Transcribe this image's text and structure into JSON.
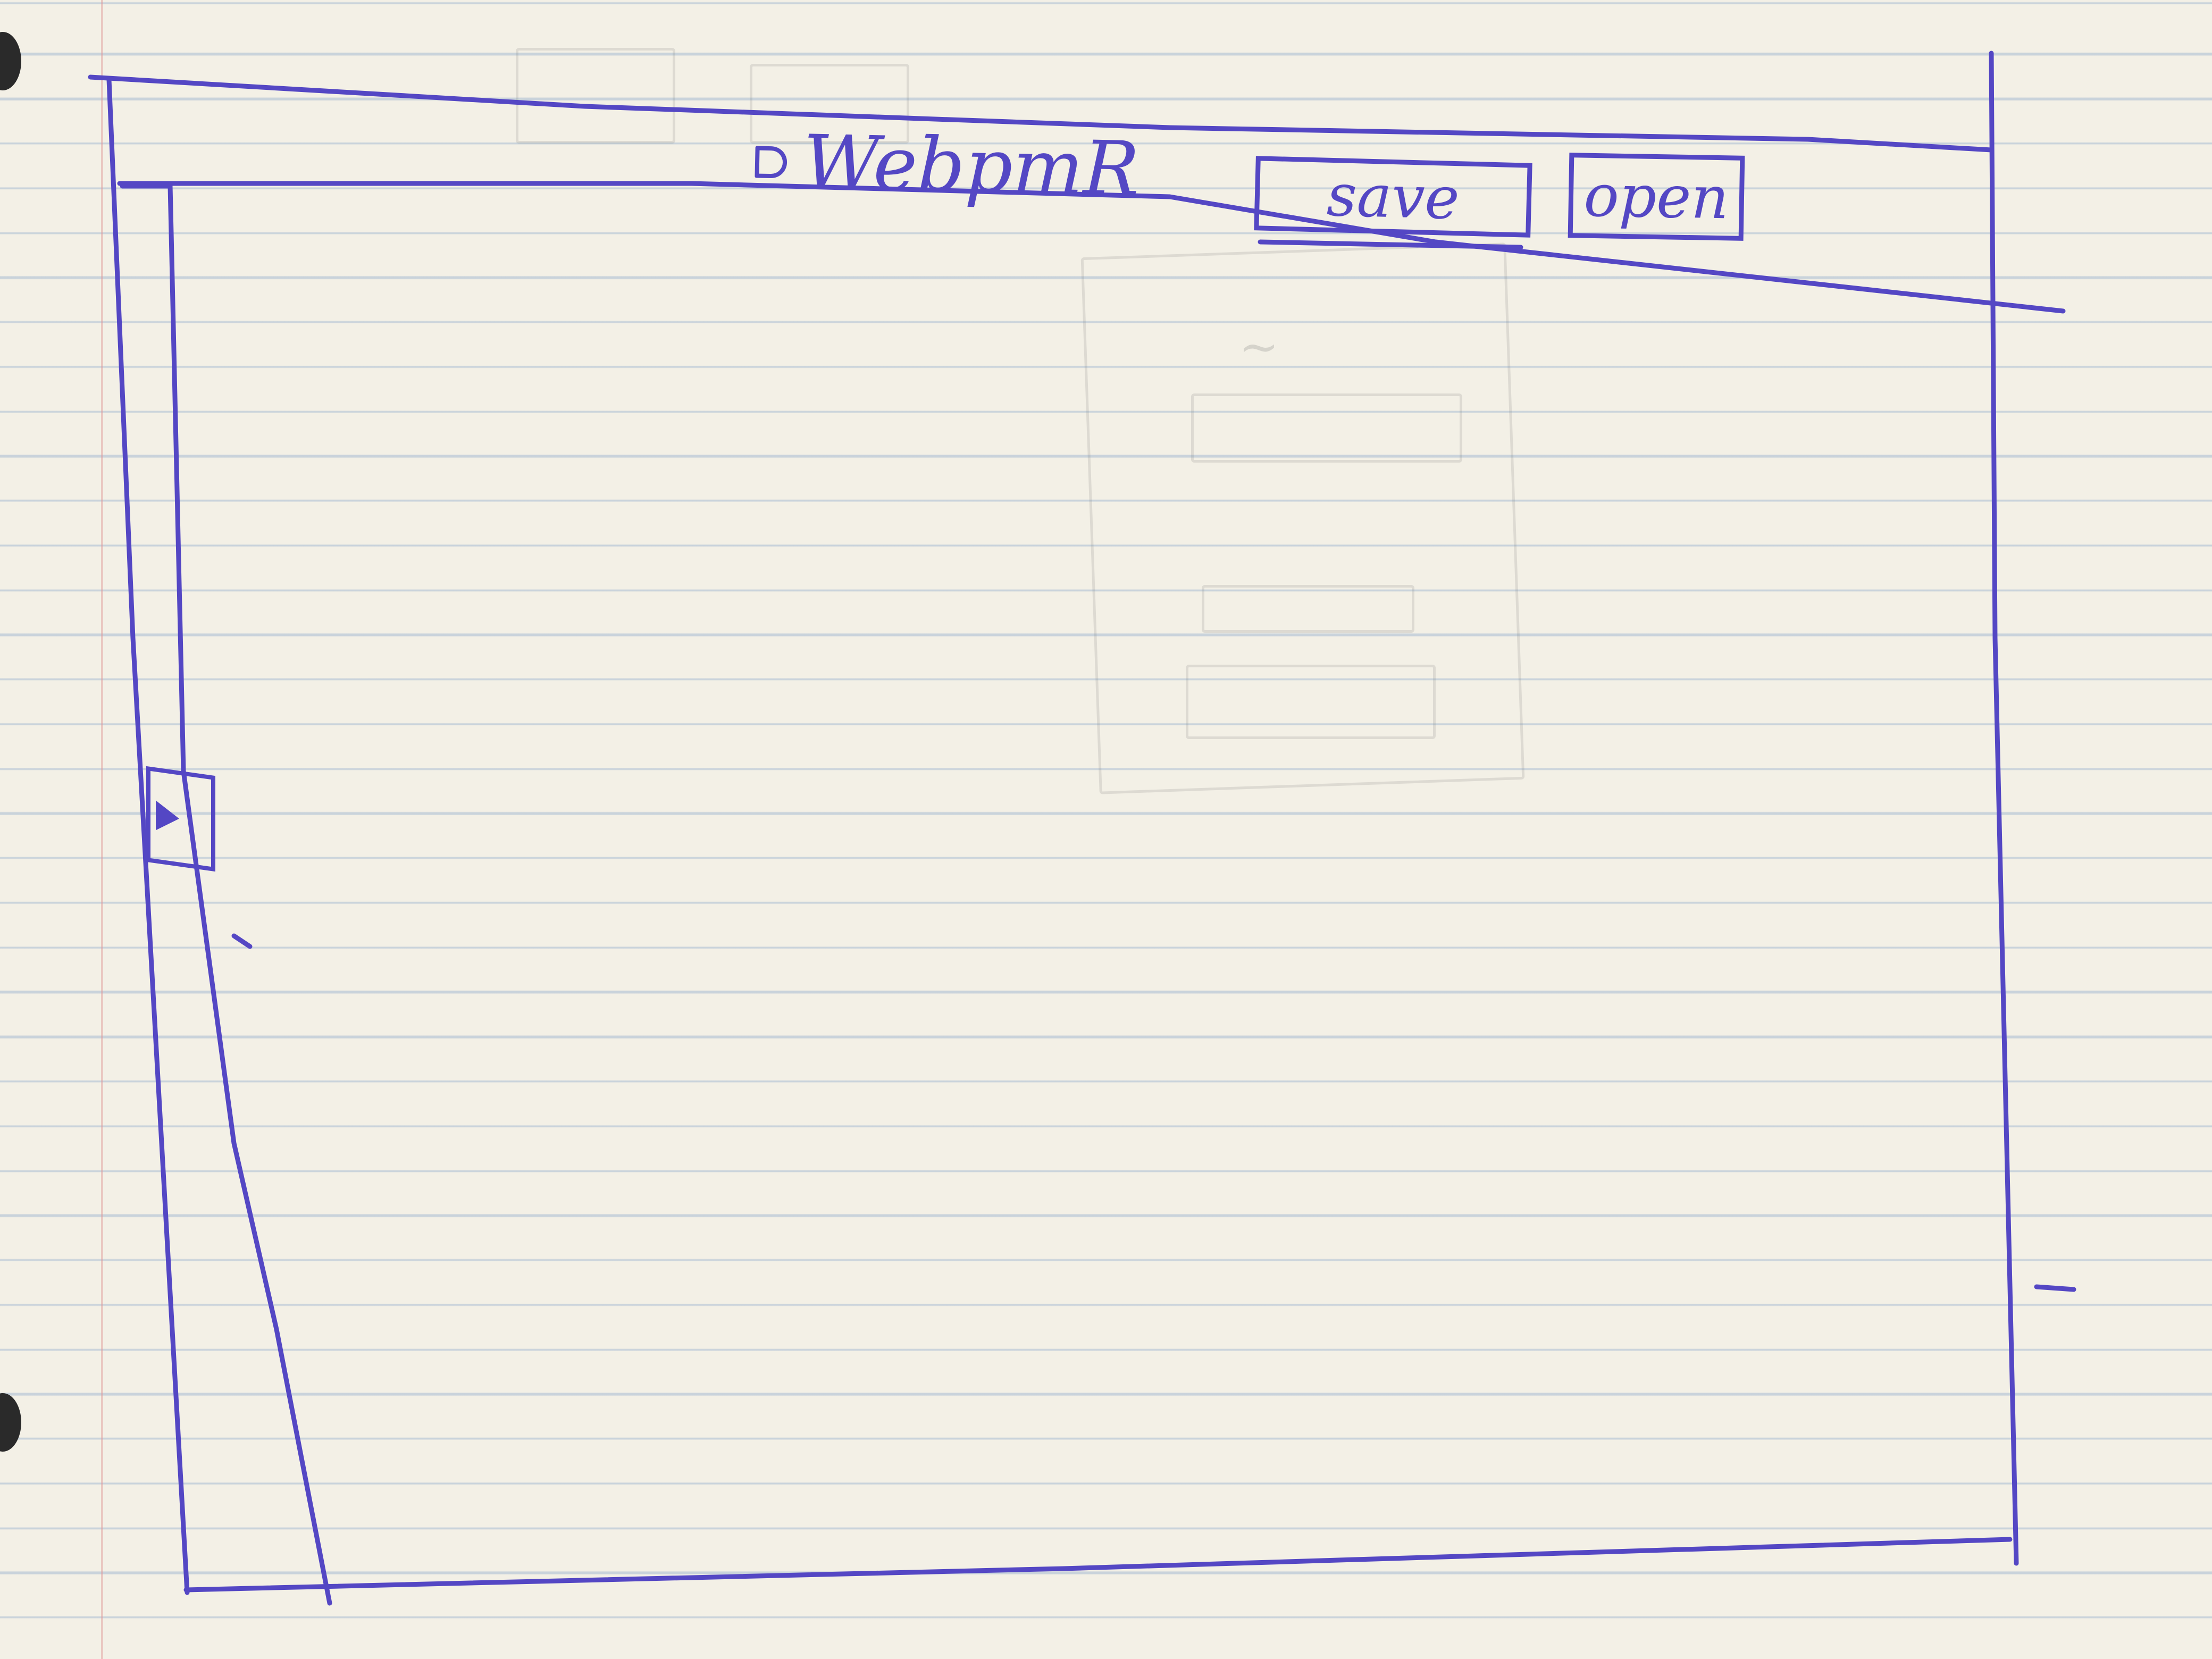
{
  "header": {
    "app_title": "WebpmR",
    "logo_icon": "document-icon"
  },
  "toolbar": {
    "save_label": "save",
    "open_label": "open"
  },
  "sidebar": {
    "toggle_icon": "chevron-right-icon"
  },
  "colors": {
    "ink": "#5447c4",
    "paper": "#f3f0e6",
    "rule_lines": "#96afcd",
    "margin_line": "#e19696"
  }
}
